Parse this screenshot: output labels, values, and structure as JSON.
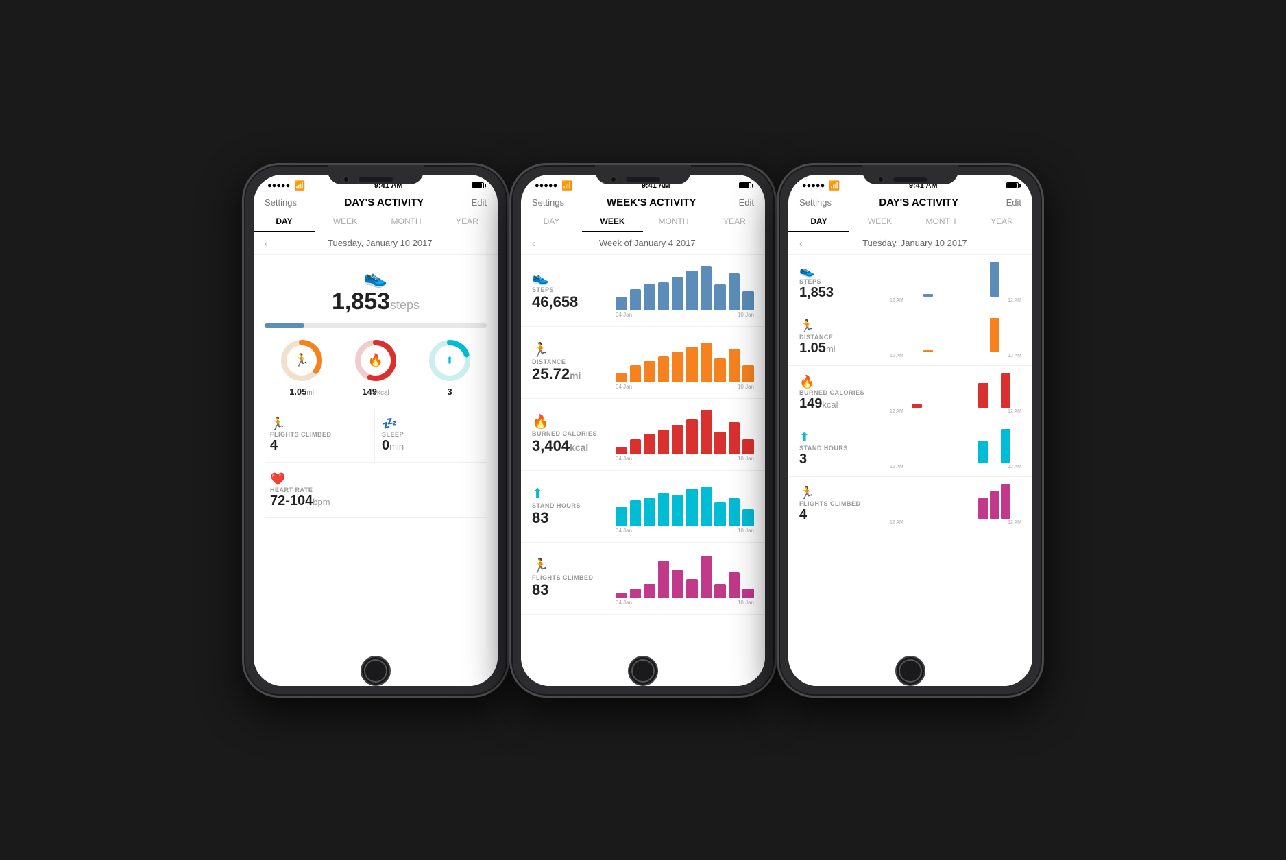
{
  "phone1": {
    "status": {
      "time": "9:41 AM",
      "signal": "●●●●●",
      "wifi": "WiFi",
      "battery": "Battery"
    },
    "nav": {
      "settings": "Settings",
      "title": "DAY'S ACTIVITY",
      "edit": "Edit"
    },
    "tabs": [
      "DAY",
      "WEEK",
      "MONTH",
      "YEAR"
    ],
    "active_tab": 0,
    "date": "Tuesday, January 10 2017",
    "steps": {
      "count": "1,853",
      "label": "steps",
      "progress": 18
    },
    "rings": [
      {
        "color": "#f5821f",
        "bg": "#f0e0cc",
        "pct": 35,
        "icon": "🏃",
        "value": "1.05",
        "unit": "mi"
      },
      {
        "color": "#d93030",
        "bg": "#f0cccc",
        "pct": 55,
        "icon": "🔥",
        "value": "149",
        "unit": "kcal"
      },
      {
        "color": "#00bcd4",
        "bg": "#cceeee",
        "pct": 20,
        "icon": "⬆",
        "value": "3",
        "unit": ""
      }
    ],
    "metrics": [
      {
        "icon": "🏃",
        "icon_color": "#c0392b",
        "label": "FLIGHTS CLIMBED",
        "value": "4",
        "unit": ""
      },
      {
        "icon": "💤",
        "icon_color": "#5b3fa0",
        "label": "SLEEP",
        "value": "0",
        "unit": "min"
      }
    ],
    "heart": {
      "icon": "♥",
      "icon_color": "#e91e63",
      "label": "HEART RATE",
      "value": "72-104",
      "unit": "bpm"
    }
  },
  "phone2": {
    "status": {
      "time": "9:41 AM"
    },
    "nav": {
      "settings": "Settings",
      "title": "WEEK'S ACTIVITY",
      "edit": "Edit"
    },
    "tabs": [
      "DAY",
      "WEEK",
      "MONTH",
      "YEAR"
    ],
    "active_tab": 1,
    "date": "Week of January 4 2017",
    "metrics": [
      {
        "icon": "👟",
        "icon_color": "#5b8db8",
        "label": "STEPS",
        "value": "46,658",
        "unit": "",
        "bar_color": "#5b8db8",
        "bars": [
          30,
          45,
          55,
          60,
          70,
          85,
          95,
          55,
          78,
          40
        ],
        "label_start": "04 Jan",
        "label_end": "10 Jan"
      },
      {
        "icon": "🏃",
        "icon_color": "#f5821f",
        "label": "DISTANCE",
        "value": "25.72",
        "unit": "mi",
        "bar_color": "#f5821f",
        "bars": [
          20,
          35,
          45,
          55,
          65,
          75,
          85,
          50,
          70,
          35
        ],
        "label_start": "04 Jan",
        "label_end": "10 Jan"
      },
      {
        "icon": "🔥",
        "icon_color": "#d93030",
        "label": "BURNED CALORIES",
        "value": "3,404",
        "unit": "kcal",
        "bar_color": "#d93030",
        "bars": [
          15,
          30,
          40,
          50,
          60,
          70,
          90,
          45,
          65,
          30
        ],
        "label_start": "04 Jan",
        "label_end": "10 Jan"
      },
      {
        "icon": "⬆",
        "icon_color": "#00bcd4",
        "label": "STAND HOURS",
        "value": "83",
        "unit": "",
        "bar_color": "#00bcd4",
        "bars": [
          40,
          55,
          60,
          70,
          65,
          80,
          85,
          50,
          60,
          35
        ],
        "label_start": "04 Jan",
        "label_end": "10 Jan"
      },
      {
        "icon": "🏃",
        "icon_color": "#c0398b",
        "label": "FLIGHTS CLIMBED",
        "value": "83",
        "unit": "",
        "bar_color": "#c0398b",
        "bars": [
          10,
          20,
          30,
          80,
          60,
          40,
          90,
          30,
          55,
          20
        ],
        "label_start": "04 Jan",
        "label_end": "10 Jan"
      }
    ]
  },
  "phone3": {
    "status": {
      "time": "9:41 AM"
    },
    "nav": {
      "settings": "Settings",
      "title": "DAY'S ACTIVITY",
      "edit": "Edit"
    },
    "tabs": [
      "DAY",
      "WEEK",
      "MONTH",
      "YEAR"
    ],
    "active_tab": 0,
    "date": "Tuesday, January 10 2017",
    "metrics": [
      {
        "icon": "👟",
        "icon_color": "#5b8db8",
        "label": "STEPS",
        "value": "1,853",
        "unit": "",
        "bar_color": "#5b8db8",
        "bars": [
          0,
          0,
          0,
          0,
          0,
          0,
          0,
          0,
          0,
          0,
          0,
          0,
          0,
          0,
          5,
          0,
          0,
          0,
          0,
          0,
          0,
          0,
          0,
          0,
          0,
          0,
          0,
          60,
          0,
          0,
          0,
          0,
          0,
          0,
          0,
          0,
          0,
          0,
          0,
          0
        ],
        "label_start": "12 AM",
        "label_end": "12 AM"
      },
      {
        "icon": "🏃",
        "icon_color": "#f5821f",
        "label": "DISTANCE",
        "value": "1.05",
        "unit": "mi",
        "bar_color": "#f5821f",
        "bars": [
          0,
          0,
          0,
          0,
          0,
          0,
          0,
          0,
          0,
          0,
          0,
          0,
          0,
          0,
          4,
          0,
          0,
          0,
          0,
          0,
          0,
          0,
          0,
          0,
          0,
          0,
          0,
          55,
          0,
          0,
          0,
          0,
          0,
          0,
          0,
          0,
          0,
          0,
          0,
          0
        ],
        "label_start": "12 AM",
        "label_end": "12 AM"
      },
      {
        "icon": "🔥",
        "icon_color": "#d93030",
        "label": "BURNED CALORIES",
        "value": "149",
        "unit": "kcal",
        "bar_color": "#d93030",
        "bars": [
          0,
          0,
          0,
          0,
          0,
          0,
          0,
          0,
          0,
          0,
          0,
          0,
          0,
          0,
          8,
          0,
          0,
          0,
          0,
          0,
          0,
          0,
          0,
          0,
          0,
          0,
          0,
          50,
          0,
          0,
          0,
          0,
          0,
          0,
          0,
          0,
          0,
          0,
          70,
          0
        ],
        "label_start": "12 AM",
        "label_end": "12 AM"
      },
      {
        "icon": "⬆",
        "icon_color": "#00bcd4",
        "label": "STAND HOURS",
        "value": "3",
        "unit": "",
        "bar_color": "#00bcd4",
        "bars": [
          0,
          0,
          0,
          0,
          0,
          0,
          0,
          0,
          0,
          0,
          0,
          0,
          0,
          0,
          0,
          0,
          0,
          0,
          0,
          0,
          0,
          0,
          0,
          0,
          0,
          0,
          0,
          0,
          0,
          0,
          45,
          0,
          0,
          0,
          0,
          0,
          0,
          0,
          70,
          0
        ],
        "label_start": "12 AM",
        "label_end": "12 AM"
      },
      {
        "icon": "🏃",
        "icon_color": "#c0398b",
        "label": "FLIGHTS CLIMBED",
        "value": "4",
        "unit": "",
        "bar_color": "#c0398b",
        "bars": [
          0,
          0,
          0,
          0,
          0,
          0,
          0,
          0,
          0,
          0,
          0,
          0,
          0,
          0,
          0,
          0,
          0,
          0,
          0,
          0,
          0,
          0,
          0,
          0,
          0,
          0,
          0,
          40,
          0,
          0,
          0,
          0,
          0,
          0,
          0,
          50,
          70,
          0,
          0,
          0
        ],
        "label_start": "12 AM",
        "label_end": "12 AM"
      }
    ]
  }
}
